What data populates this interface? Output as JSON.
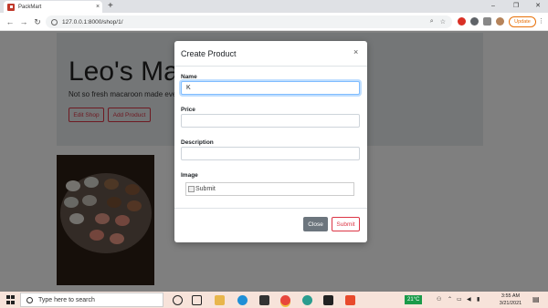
{
  "browser": {
    "tab_title": "PackMart",
    "tab_close": "×",
    "new_tab": "+",
    "window_controls": {
      "minimize": "–",
      "maximize": "❐",
      "close": "✕"
    },
    "nav": {
      "back": "←",
      "forward": "→",
      "reload": "↻"
    },
    "url": "127.0.0.1:8000/shop/1/",
    "update_label": "Update",
    "menu": "⋮",
    "omnibox_icons": [
      "search-icon",
      "star-icon"
    ],
    "colors": {
      "extension_red": "#d93025",
      "extension_green": "#34a853",
      "extension_gray": "#5f6368"
    }
  },
  "page": {
    "shop_title": "Leo's Macaroons",
    "shop_description": "Not so fresh macaroon made every day.",
    "edit_shop_label": "Edit Shop",
    "add_product_label": "Add Product",
    "product_image_alt": "macaroons plate"
  },
  "modal": {
    "title": "Create Product",
    "close_symbol": "×",
    "fields": {
      "name_label": "Name",
      "name_value": "K",
      "price_label": "Price",
      "price_value": "",
      "description_label": "Description",
      "description_value": "",
      "image_label": "Image",
      "image_alt": "Submit"
    },
    "close_button": "Close",
    "submit_button": "Submit",
    "colors": {
      "accent": "#dc3545",
      "secondary": "#6c757d"
    }
  },
  "taskbar": {
    "search_placeholder": "Type here to search",
    "temperature": "21°C",
    "time": "3:55 AM",
    "date": "3/21/2021",
    "notifications": "2"
  }
}
